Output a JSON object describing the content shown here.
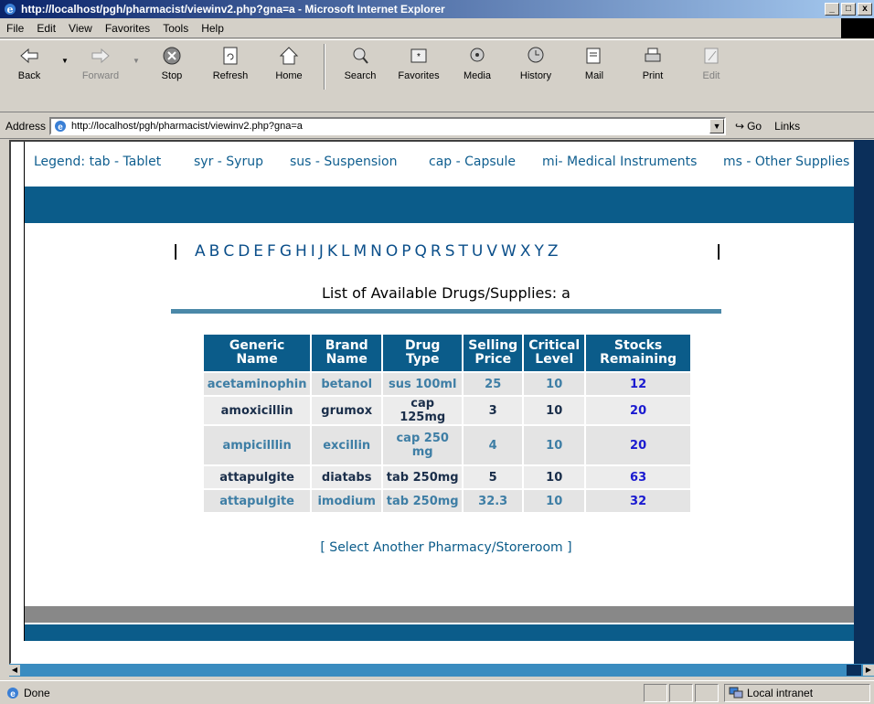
{
  "window": {
    "title": "http://localhost/pgh/pharmacist/viewinv2.php?gna=a - Microsoft Internet Explorer",
    "buttons": [
      "_",
      "□",
      "x"
    ]
  },
  "menu": [
    "File",
    "Edit",
    "View",
    "Favorites",
    "Tools",
    "Help"
  ],
  "toolbar": {
    "back": "Back",
    "forward": "Forward",
    "stop": "Stop",
    "refresh": "Refresh",
    "home": "Home",
    "search": "Search",
    "favorites": "Favorites",
    "media": "Media",
    "history": "History",
    "mail": "Mail",
    "print": "Print",
    "edit": "Edit"
  },
  "address": {
    "label": "Address",
    "url": "http://localhost/pgh/pharmacist/viewinv2.php?gna=a",
    "go": "Go",
    "links": "Links"
  },
  "legend": [
    "Legend: tab - Tablet",
    "syr - Syrup",
    "sus - Suspension",
    "cap - Capsule",
    "mi- Medical Instruments",
    "ms - Other Supplies"
  ],
  "alphabet": [
    "A",
    "B",
    "C",
    "D",
    "E",
    "F",
    "G",
    "H",
    "I",
    "J",
    "K",
    "L",
    "M",
    "N",
    "O",
    "P",
    "Q",
    "R",
    "S",
    "T",
    "U",
    "V",
    "W",
    "X",
    "Y",
    "Z"
  ],
  "list_heading": "List of Available Drugs/Supplies: a",
  "table": {
    "headers": [
      "Generic Name",
      "Brand Name",
      "Drug Type",
      "Selling Price",
      "Critical Level",
      "Stocks Remaining"
    ],
    "rows": [
      [
        "acetaminophin",
        "betanol",
        "sus 100ml",
        "25",
        "10",
        "12"
      ],
      [
        "amoxicillin",
        "grumox",
        "cap 125mg",
        "3",
        "10",
        "20"
      ],
      [
        "ampicilllin",
        "excillin",
        "cap 250 mg",
        "4",
        "10",
        "20"
      ],
      [
        "attapulgite",
        "diatabs",
        "tab 250mg",
        "5",
        "10",
        "63"
      ],
      [
        "attapulgite",
        "imodium",
        "tab 250mg",
        "32.3",
        "10",
        "32"
      ]
    ]
  },
  "select_link": "[ Select Another Pharmacy/Storeroom ]",
  "status": {
    "text": "Done",
    "zone": "Local intranet"
  },
  "colors": {
    "brand_blue": "#0b5c8a",
    "title_gradient_start": "#0a246a"
  }
}
